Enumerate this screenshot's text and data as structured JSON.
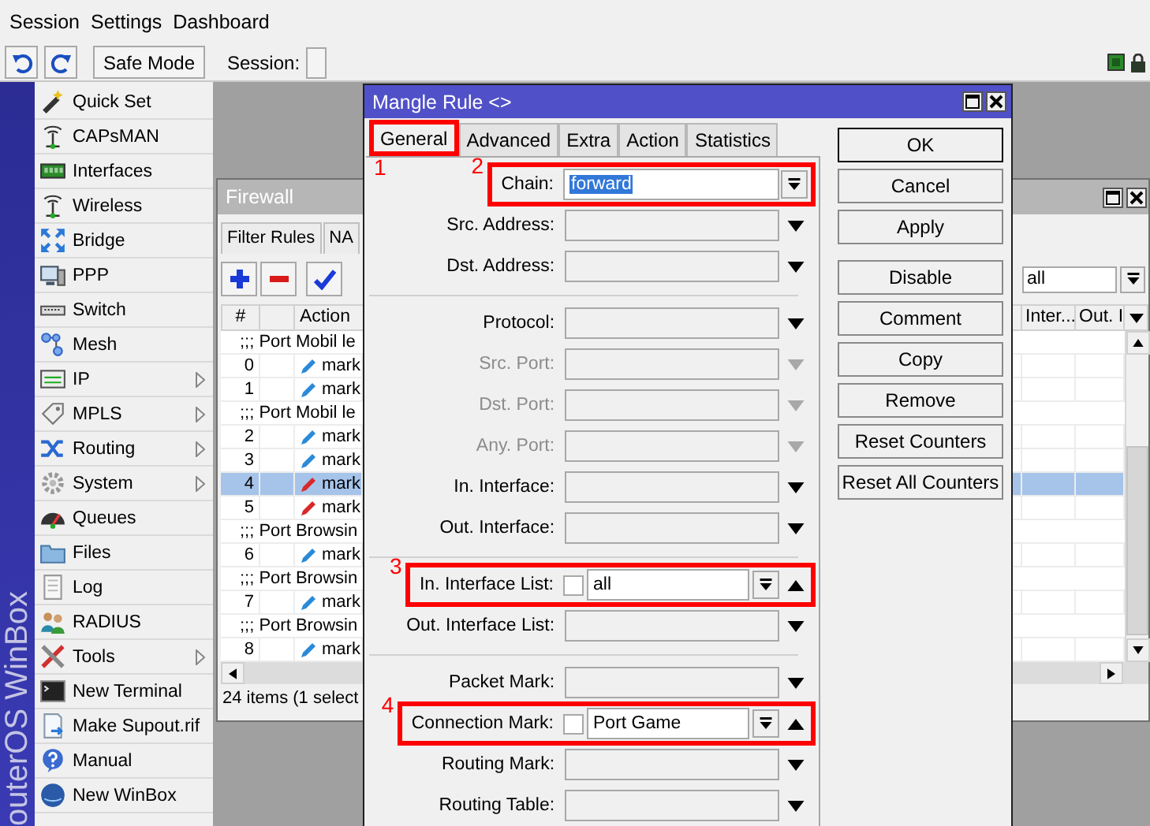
{
  "menu": [
    {
      "label": "Session"
    },
    {
      "label": "Settings"
    },
    {
      "label": "Dashboard"
    }
  ],
  "toolbar": {
    "safe_mode": "Safe Mode",
    "session_label": "Session:"
  },
  "brand": "outerOS WinBox",
  "sidebar": {
    "items": [
      {
        "label": "Quick Set",
        "has_submenu": false
      },
      {
        "label": "CAPsMAN",
        "has_submenu": false
      },
      {
        "label": "Interfaces",
        "has_submenu": false
      },
      {
        "label": "Wireless",
        "has_submenu": false
      },
      {
        "label": "Bridge",
        "has_submenu": false
      },
      {
        "label": "PPP",
        "has_submenu": false
      },
      {
        "label": "Switch",
        "has_submenu": false
      },
      {
        "label": "Mesh",
        "has_submenu": false
      },
      {
        "label": "IP",
        "has_submenu": true
      },
      {
        "label": "MPLS",
        "has_submenu": true
      },
      {
        "label": "Routing",
        "has_submenu": true
      },
      {
        "label": "System",
        "has_submenu": true
      },
      {
        "label": "Queues",
        "has_submenu": false
      },
      {
        "label": "Files",
        "has_submenu": false
      },
      {
        "label": "Log",
        "has_submenu": false
      },
      {
        "label": "RADIUS",
        "has_submenu": false
      },
      {
        "label": "Tools",
        "has_submenu": true
      },
      {
        "label": "New Terminal",
        "has_submenu": false
      },
      {
        "label": "Make Supout.rif",
        "has_submenu": false
      },
      {
        "label": "Manual",
        "has_submenu": false
      },
      {
        "label": "New WinBox",
        "has_submenu": false
      }
    ]
  },
  "firewall": {
    "title": "Firewall",
    "tabs": [
      {
        "label": "Filter Rules",
        "selected": false
      },
      {
        "label": "NA",
        "selected": false
      }
    ],
    "filter": {
      "value": "all"
    },
    "columns_left": [
      "#",
      "Action"
    ],
    "columns_right": [
      "Inter...",
      "Out. I"
    ],
    "rows": [
      {
        "kind": "comment",
        "text": ";;; Port Mobil le",
        "selected": false
      },
      {
        "kind": "rule",
        "number": "0",
        "action": "mark",
        "color": "#2a8ad8",
        "selected": false
      },
      {
        "kind": "rule",
        "number": "1",
        "action": "mark",
        "color": "#2a8ad8",
        "selected": false
      },
      {
        "kind": "comment",
        "text": ";;; Port Mobil le",
        "selected": false
      },
      {
        "kind": "rule",
        "number": "2",
        "action": "mark",
        "color": "#2a8ad8",
        "selected": false
      },
      {
        "kind": "rule",
        "number": "3",
        "action": "mark",
        "color": "#2a8ad8",
        "selected": false
      },
      {
        "kind": "rule",
        "number": "4",
        "action": "mark",
        "color": "#d82828",
        "selected": true
      },
      {
        "kind": "rule",
        "number": "5",
        "action": "mark",
        "color": "#d82828",
        "selected": false
      },
      {
        "kind": "comment",
        "text": ";;; Port Browsin",
        "selected": false
      },
      {
        "kind": "rule",
        "number": "6",
        "action": "mark",
        "color": "#2a8ad8",
        "selected": false
      },
      {
        "kind": "comment",
        "text": ";;; Port Browsin",
        "selected": false
      },
      {
        "kind": "rule",
        "number": "7",
        "action": "mark",
        "color": "#2a8ad8",
        "selected": false
      },
      {
        "kind": "comment",
        "text": ";;; Port Browsin",
        "selected": false
      },
      {
        "kind": "rule",
        "number": "8",
        "action": "mark",
        "color": "#2a8ad8",
        "selected": false
      }
    ],
    "status": "24 items (1 select"
  },
  "dialog": {
    "title": "Mangle Rule <>",
    "tabs": [
      {
        "label": "General",
        "selected": true,
        "annotation": "1"
      },
      {
        "label": "Advanced",
        "selected": false
      },
      {
        "label": "Extra",
        "selected": false
      },
      {
        "label": "Action",
        "selected": false
      },
      {
        "label": "Statistics",
        "selected": false
      }
    ],
    "rows": [
      {
        "kind": "select",
        "label": "Chain:",
        "value": "forward",
        "value_selected": true,
        "annotation": "2"
      },
      {
        "kind": "combo",
        "label": "Src. Address:",
        "disabled": false
      },
      {
        "kind": "combo",
        "label": "Dst. Address:",
        "disabled": false
      },
      {
        "kind": "separator"
      },
      {
        "kind": "combo",
        "label": "Protocol:",
        "disabled": false
      },
      {
        "kind": "combo",
        "label": "Src. Port:",
        "disabled": true
      },
      {
        "kind": "combo",
        "label": "Dst. Port:",
        "disabled": true
      },
      {
        "kind": "combo",
        "label": "Any. Port:",
        "disabled": true
      },
      {
        "kind": "combo",
        "label": "In. Interface:",
        "disabled": false
      },
      {
        "kind": "combo",
        "label": "Out. Interface:",
        "disabled": false
      },
      {
        "kind": "separator"
      },
      {
        "kind": "list",
        "label": "In. Interface List:",
        "checked": false,
        "value": "all",
        "annotation": "3"
      },
      {
        "kind": "combo",
        "label": "Out. Interface List:",
        "disabled": false
      },
      {
        "kind": "separator"
      },
      {
        "kind": "combo",
        "label": "Packet Mark:",
        "disabled": false
      },
      {
        "kind": "list",
        "label": "Connection Mark:",
        "checked": false,
        "value": "Port Game",
        "annotation": "4"
      },
      {
        "kind": "combo",
        "label": "Routing Mark:",
        "disabled": false
      },
      {
        "kind": "combo",
        "label": "Routing Table:",
        "disabled": false
      }
    ],
    "button_groups": [
      {
        "buttons": [
          {
            "label": "OK",
            "default": true
          },
          {
            "label": "Cancel",
            "default": false
          },
          {
            "label": "Apply",
            "default": false
          }
        ]
      },
      {
        "buttons": [
          {
            "label": "Disable",
            "default": false
          },
          {
            "label": "Comment",
            "default": false
          },
          {
            "label": "Copy",
            "default": false
          },
          {
            "label": "Remove",
            "default": false
          },
          {
            "label": "Reset Counters",
            "default": false
          },
          {
            "label": "Reset All Counters",
            "default": false
          }
        ]
      }
    ]
  }
}
